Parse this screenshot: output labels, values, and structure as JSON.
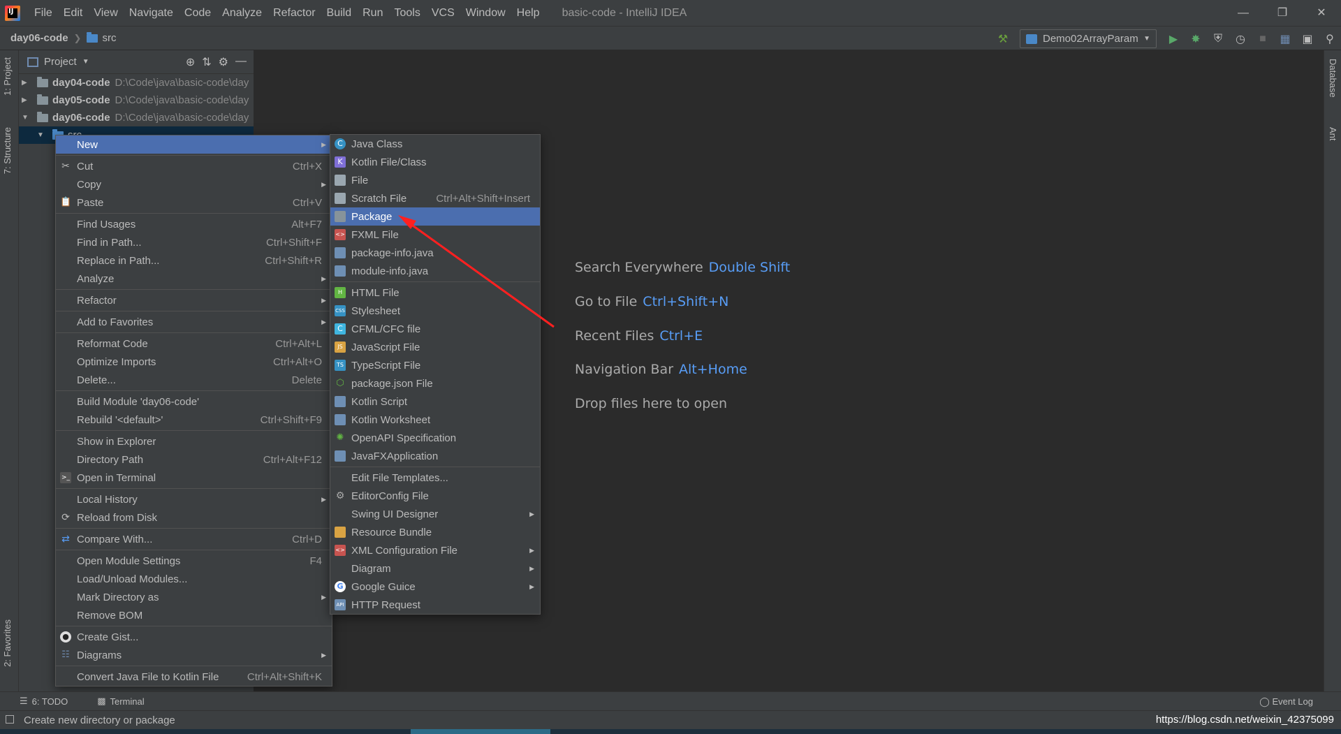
{
  "app": {
    "window_title": "basic-code - IntelliJ IDEA",
    "menu": [
      "File",
      "Edit",
      "View",
      "Navigate",
      "Code",
      "Analyze",
      "Refactor",
      "Build",
      "Run",
      "Tools",
      "VCS",
      "Window",
      "Help"
    ]
  },
  "navbar": {
    "project": "day06-code",
    "folder": "src",
    "run_config": "Demo02ArrayParam"
  },
  "left_strip": {
    "project_tab": "1: Project",
    "structure_tab": "7: Structure",
    "favorites_tab": "2: Favorites"
  },
  "right_strip": {
    "database_tab": "Database",
    "ant_tab": "Ant"
  },
  "project_panel": {
    "title": "Project",
    "tree": [
      {
        "name": "day04-code",
        "path": "D:\\Code\\java\\basic-code\\day"
      },
      {
        "name": "day05-code",
        "path": "D:\\Code\\java\\basic-code\\day"
      },
      {
        "name": "day06-code",
        "path": "D:\\Code\\java\\basic-code\\day"
      },
      {
        "name": "src",
        "path": ""
      }
    ]
  },
  "editor": {
    "hints": [
      {
        "label": "Search Everywhere",
        "shortcut": "Double Shift"
      },
      {
        "label": "Go to File",
        "shortcut": "Ctrl+Shift+N"
      },
      {
        "label": "Recent Files",
        "shortcut": "Ctrl+E"
      },
      {
        "label": "Navigation Bar",
        "shortcut": "Alt+Home"
      },
      {
        "label": "Drop files here to open",
        "shortcut": ""
      }
    ]
  },
  "context_menu": [
    {
      "label": "New",
      "shortcut": "",
      "submenu": true
    },
    {
      "label": "Cut",
      "shortcut": "Ctrl+X"
    },
    {
      "label": "Copy",
      "shortcut": "",
      "submenu": true
    },
    {
      "label": "Paste",
      "shortcut": "Ctrl+V"
    },
    {
      "label": "Find Usages",
      "shortcut": "Alt+F7"
    },
    {
      "label": "Find in Path...",
      "shortcut": "Ctrl+Shift+F"
    },
    {
      "label": "Replace in Path...",
      "shortcut": "Ctrl+Shift+R"
    },
    {
      "label": "Analyze",
      "shortcut": "",
      "submenu": true
    },
    {
      "label": "Refactor",
      "shortcut": "",
      "submenu": true
    },
    {
      "label": "Add to Favorites",
      "shortcut": "",
      "submenu": true
    },
    {
      "label": "Reformat Code",
      "shortcut": "Ctrl+Alt+L"
    },
    {
      "label": "Optimize Imports",
      "shortcut": "Ctrl+Alt+O"
    },
    {
      "label": "Delete...",
      "shortcut": "Delete"
    },
    {
      "label": "Build Module 'day06-code'",
      "shortcut": ""
    },
    {
      "label": "Rebuild '<default>'",
      "shortcut": "Ctrl+Shift+F9"
    },
    {
      "label": "Show in Explorer",
      "shortcut": ""
    },
    {
      "label": "Directory Path",
      "shortcut": "Ctrl+Alt+F12"
    },
    {
      "label": "Open in Terminal",
      "shortcut": ""
    },
    {
      "label": "Local History",
      "shortcut": "",
      "submenu": true
    },
    {
      "label": "Reload from Disk",
      "shortcut": ""
    },
    {
      "label": "Compare With...",
      "shortcut": "Ctrl+D"
    },
    {
      "label": "Open Module Settings",
      "shortcut": "F4"
    },
    {
      "label": "Load/Unload Modules...",
      "shortcut": ""
    },
    {
      "label": "Mark Directory as",
      "shortcut": "",
      "submenu": true
    },
    {
      "label": "Remove BOM",
      "shortcut": ""
    },
    {
      "label": "Create Gist...",
      "shortcut": ""
    },
    {
      "label": "Diagrams",
      "shortcut": "",
      "submenu": true
    },
    {
      "label": "Convert Java File to Kotlin File",
      "shortcut": "Ctrl+Alt+Shift+K"
    }
  ],
  "new_submenu": [
    {
      "label": "Java Class",
      "shortcut": ""
    },
    {
      "label": "Kotlin File/Class",
      "shortcut": ""
    },
    {
      "label": "File",
      "shortcut": ""
    },
    {
      "label": "Scratch File",
      "shortcut": "Ctrl+Alt+Shift+Insert"
    },
    {
      "label": "Package",
      "shortcut": ""
    },
    {
      "label": "FXML File",
      "shortcut": ""
    },
    {
      "label": "package-info.java",
      "shortcut": ""
    },
    {
      "label": "module-info.java",
      "shortcut": ""
    },
    {
      "label": "HTML File",
      "shortcut": ""
    },
    {
      "label": "Stylesheet",
      "shortcut": ""
    },
    {
      "label": "CFML/CFC file",
      "shortcut": ""
    },
    {
      "label": "JavaScript File",
      "shortcut": ""
    },
    {
      "label": "TypeScript File",
      "shortcut": ""
    },
    {
      "label": "package.json File",
      "shortcut": ""
    },
    {
      "label": "Kotlin Script",
      "shortcut": ""
    },
    {
      "label": "Kotlin Worksheet",
      "shortcut": ""
    },
    {
      "label": "OpenAPI Specification",
      "shortcut": ""
    },
    {
      "label": "JavaFXApplication",
      "shortcut": ""
    },
    {
      "label": "Edit File Templates...",
      "shortcut": ""
    },
    {
      "label": "EditorConfig File",
      "shortcut": ""
    },
    {
      "label": "Swing UI Designer",
      "shortcut": "",
      "submenu": true
    },
    {
      "label": "Resource Bundle",
      "shortcut": ""
    },
    {
      "label": "XML Configuration File",
      "shortcut": "",
      "submenu": true
    },
    {
      "label": "Diagram",
      "shortcut": "",
      "submenu": true
    },
    {
      "label": "Google Guice",
      "shortcut": "",
      "submenu": true
    },
    {
      "label": "HTTP Request",
      "shortcut": ""
    }
  ],
  "bottom_tools": {
    "todo": "6: TODO",
    "terminal": "Terminal",
    "event_log": "Event Log"
  },
  "status": {
    "text": "Create new directory or package",
    "url": "https://blog.csdn.net/weixin_42375099"
  },
  "colors": {
    "highlight": "#4b6eaf",
    "shortcut_blue": "#589df6",
    "annotation_arrow": "#ff2020"
  }
}
